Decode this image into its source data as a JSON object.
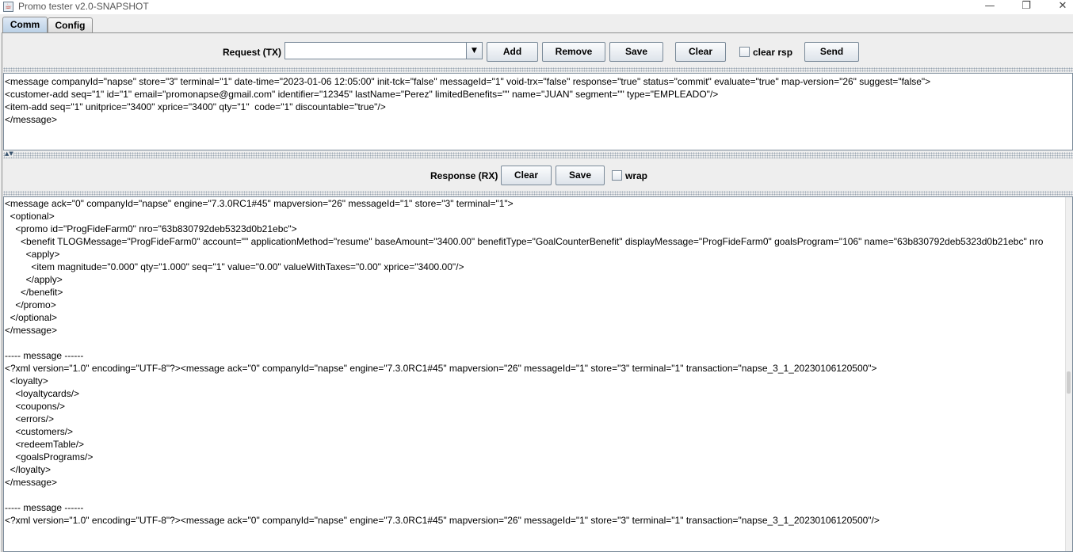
{
  "window": {
    "title": "Promo tester v2.0-SNAPSHOT",
    "minimize_glyph": "—",
    "restore_glyph": "❐",
    "close_glyph": "✕"
  },
  "tabs": [
    {
      "label": "Comm",
      "active": true
    },
    {
      "label": "Config",
      "active": false
    }
  ],
  "request": {
    "label": "Request (TX)",
    "combo_value": "",
    "add_label": "Add",
    "remove_label": "Remove",
    "save_label": "Save",
    "clear_label": "Clear",
    "clear_rsp_label": "clear rsp",
    "clear_rsp_checked": false,
    "send_label": "Send",
    "lines": [
      "<message companyId=\"napse\" store=\"3\" terminal=\"1\" date-time=\"2023-01-06 12:05:00\" init-tck=\"false\" messageId=\"1\" void-trx=\"false\" response=\"true\" status=\"commit\" evaluate=\"true\" map-version=\"26\" suggest=\"false\">",
      "<customer-add seq=\"1\" id=\"1\" email=\"promonapse@gmail.com\" identifier=\"12345\" lastName=\"Perez\" limitedBenefits=\"\" name=\"JUAN\" segment=\"\" type=\"EMPLEADO\"/>",
      "<item-add seq=\"1\" unitprice=\"3400\" xprice=\"3400\" qty=\"1\"  code=\"1\" discountable=\"true\"/>",
      "</message>"
    ]
  },
  "response": {
    "label": "Response (RX)",
    "clear_label": "Clear",
    "save_label": "Save",
    "wrap_label": "wrap",
    "wrap_checked": false,
    "lines": [
      "<message ack=\"0\" companyId=\"napse\" engine=\"7.3.0RC1#45\" mapversion=\"26\" messageId=\"1\" store=\"3\" terminal=\"1\">",
      "  <optional>",
      "    <promo id=\"ProgFideFarm0\" nro=\"63b830792deb5323d0b21ebc\">",
      "      <benefit TLOGMessage=\"ProgFideFarm0\" account=\"\" applicationMethod=\"resume\" baseAmount=\"3400.00\" benefitType=\"GoalCounterBenefit\" displayMessage=\"ProgFideFarm0\" goalsProgram=\"106\" name=\"63b830792deb5323d0b21ebc\" nro",
      "        <apply>",
      "          <item magnitude=\"0.000\" qty=\"1.000\" seq=\"1\" value=\"0.00\" valueWithTaxes=\"0.00\" xprice=\"3400.00\"/>",
      "        </apply>",
      "      </benefit>",
      "    </promo>",
      "  </optional>",
      "</message>",
      "",
      "----- message ------",
      "<?xml version=\"1.0\" encoding=\"UTF-8\"?><message ack=\"0\" companyId=\"napse\" engine=\"7.3.0RC1#45\" mapversion=\"26\" messageId=\"1\" store=\"3\" terminal=\"1\" transaction=\"napse_3_1_20230106120500\">",
      "  <loyalty>",
      "    <loyaltycards/>",
      "    <coupons/>",
      "    <errors/>",
      "    <customers/>",
      "    <redeemTable/>",
      "    <goalsPrograms/>",
      "  </loyalty>",
      "</message>",
      "",
      "----- message ------",
      "<?xml version=\"1.0\" encoding=\"UTF-8\"?><message ack=\"0\" companyId=\"napse\" engine=\"7.3.0RC1#45\" mapversion=\"26\" messageId=\"1\" store=\"3\" terminal=\"1\" transaction=\"napse_3_1_20230106120500\"/>"
    ]
  }
}
